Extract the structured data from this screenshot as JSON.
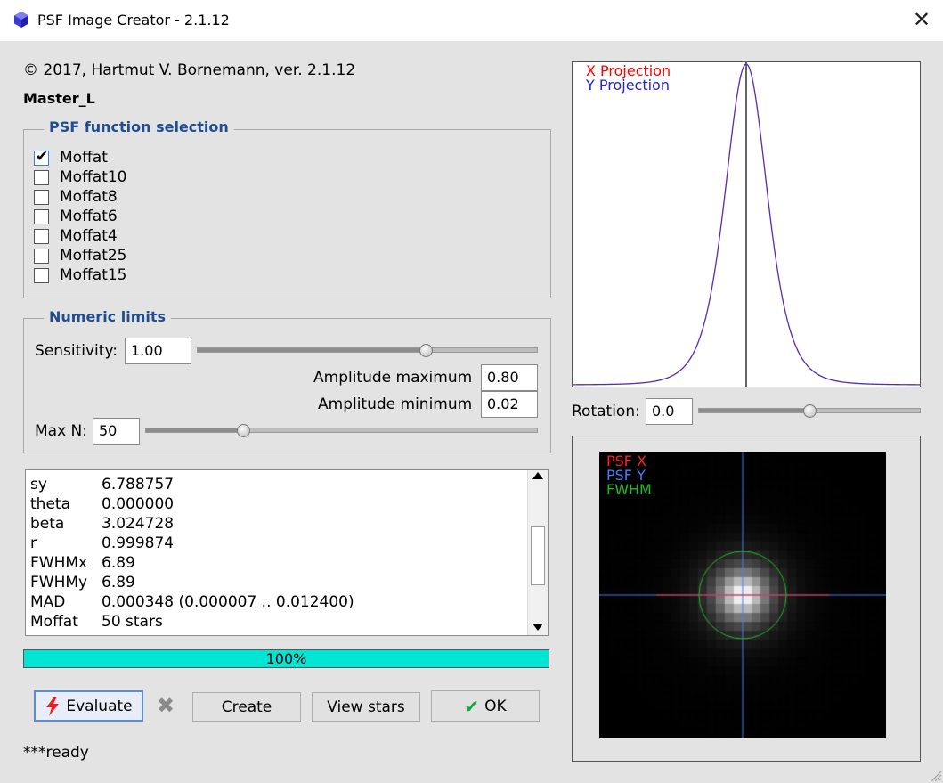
{
  "window": {
    "title": "PSF Image Creator - 2.1.12"
  },
  "header": {
    "copyright": "© 2017, Hartmut V. Bornemann, ver. 2.1.12",
    "image_name": "Master_L"
  },
  "psf_selection": {
    "title": "PSF function selection",
    "options": [
      {
        "label": "Moffat",
        "checked": true
      },
      {
        "label": "Moffat10",
        "checked": false
      },
      {
        "label": "Moffat8",
        "checked": false
      },
      {
        "label": "Moffat6",
        "checked": false
      },
      {
        "label": "Moffat4",
        "checked": false
      },
      {
        "label": "Moffat25",
        "checked": false
      },
      {
        "label": "Moffat15",
        "checked": false
      }
    ]
  },
  "numeric_limits": {
    "title": "Numeric limits",
    "sensitivity_label": "Sensitivity:",
    "sensitivity_value": "1.00",
    "sensitivity_slider_fraction": 0.67,
    "amp_max_label": "Amplitude maximum",
    "amp_max_value": "0.80",
    "amp_min_label": "Amplitude minimum",
    "amp_min_value": "0.02",
    "maxn_label": "Max N:",
    "maxn_value": "50",
    "maxn_slider_fraction": 0.25
  },
  "results": [
    {
      "key": "sy",
      "value": "6.788757"
    },
    {
      "key": "theta",
      "value": "0.000000"
    },
    {
      "key": "beta",
      "value": "3.024728"
    },
    {
      "key": "r",
      "value": "0.999874"
    },
    {
      "key": "FWHMx",
      "value": "6.89"
    },
    {
      "key": "FWHMy",
      "value": "6.89"
    },
    {
      "key": "MAD",
      "value": "0.000348 (0.000007 .. 0.012400)"
    },
    {
      "key": "Moffat",
      "value": "50 stars"
    }
  ],
  "progress": {
    "label": "100%",
    "value": 1.0,
    "color": "#00e5d4"
  },
  "buttons": {
    "evaluate": "Evaluate",
    "cancel_glyph": "✖",
    "create": "Create",
    "view_stars": "View stars",
    "ok": "OK"
  },
  "status": "***ready",
  "projection_plot": {
    "legend_x": "X Projection",
    "legend_y": "Y Projection",
    "x_color": "#ff0000",
    "y_color": "#2222dd",
    "curve_color": "#5a2ab0"
  },
  "rotation": {
    "label": "Rotation:",
    "value": "0.0",
    "slider_fraction": 0.5
  },
  "psf_image": {
    "legend_x": "PSF X",
    "legend_y": "PSF Y",
    "legend_fwhm": "FWHM",
    "x_color": "#ff2222",
    "y_color": "#4a7cff",
    "fwhm_color": "#22bb22"
  }
}
